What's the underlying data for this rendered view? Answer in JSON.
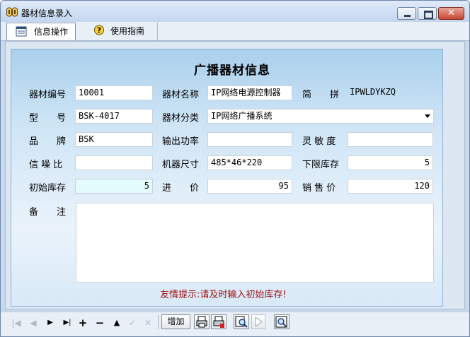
{
  "window": {
    "title": "器材信息录入"
  },
  "tabs": [
    {
      "label": "信息操作",
      "icon": "form-icon",
      "active": true
    },
    {
      "label": "使用指南",
      "icon": "help-icon",
      "active": false
    }
  ],
  "form": {
    "heading": "广播器材信息",
    "fields": {
      "code": {
        "label": "器材编号",
        "value": "10001"
      },
      "name": {
        "label": "器材名称",
        "value": "IP网络电源控制器"
      },
      "pinyin": {
        "label": "简　　拼",
        "value": "IPWLDYKZQ"
      },
      "model": {
        "label": "型　　号",
        "value": "BSK-4017"
      },
      "category": {
        "label": "器材分类",
        "value": "IP网络广播系统"
      },
      "brand": {
        "label": "品　　牌",
        "value": "BSK"
      },
      "power": {
        "label": "输出功率",
        "value": ""
      },
      "sensitivity": {
        "label": "灵 敏 度",
        "value": ""
      },
      "snr": {
        "label": "信 噪 比",
        "value": ""
      },
      "size": {
        "label": "机器尺寸",
        "value": "485*46*220"
      },
      "min_stock": {
        "label": "下限库存",
        "value": "5"
      },
      "init_stock": {
        "label": "初始库存",
        "value": "5"
      },
      "purchase_price": {
        "label": "进　　价",
        "value": "95"
      },
      "sale_price": {
        "label": "销 售 价",
        "value": "120"
      },
      "remark": {
        "label": "备　　注",
        "value": ""
      }
    },
    "hint": "友情提示:请及时输入初始库存!"
  },
  "toolbar": {
    "add_label": "增加",
    "buttons": [
      "first-icon",
      "prev-icon",
      "next-icon",
      "last-icon",
      "insert-icon",
      "delete-icon",
      "edit-icon",
      "post-icon",
      "cancel-icon",
      "print-icon",
      "print-preview-icon",
      "search-icon",
      "play-icon",
      "find-icon"
    ]
  },
  "colors": {
    "hint": "#a21212",
    "panel_top": "#aad0ec",
    "highlight_field": "#e4fbfc"
  }
}
